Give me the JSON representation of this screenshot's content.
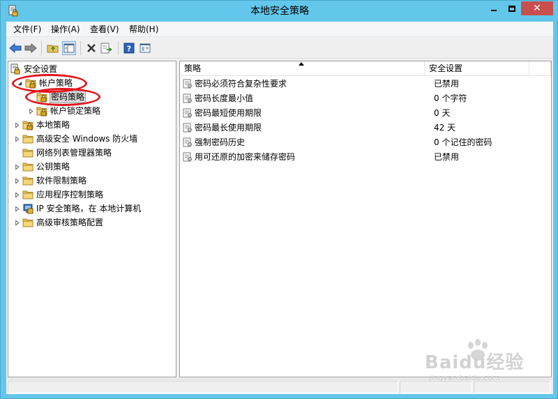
{
  "window": {
    "title": "本地安全策略",
    "close_glyph": "✕"
  },
  "menu": [
    {
      "label": "文件(F)"
    },
    {
      "label": "操作(A)"
    },
    {
      "label": "查看(V)"
    },
    {
      "label": "帮助(H)"
    }
  ],
  "toolbar": {
    "icons": [
      "back-arrow-icon",
      "forward-arrow-icon",
      "up-folder-icon",
      "show-hide-tree-icon",
      "delete-icon",
      "export-list-icon",
      "help-icon",
      "console-icon"
    ]
  },
  "tree": {
    "items": [
      {
        "label": "安全设置"
      },
      {
        "label": "帐户策略"
      },
      {
        "label": "密码策略"
      },
      {
        "label": "帐户锁定策略"
      },
      {
        "label": "本地策略"
      },
      {
        "label": "高级安全 Windows 防火墙"
      },
      {
        "label": "网络列表管理器策略"
      },
      {
        "label": "公钥策略"
      },
      {
        "label": "软件限制策略"
      },
      {
        "label": "应用程序控制策略"
      },
      {
        "label": "IP 安全策略，在 本地计算机"
      },
      {
        "label": "高级审核策略配置"
      }
    ]
  },
  "list": {
    "columns": [
      {
        "label": "策略"
      },
      {
        "label": "安全设置"
      }
    ],
    "rows": [
      {
        "policy": "密码必须符合复杂性要求",
        "setting": "已禁用"
      },
      {
        "policy": "密码长度最小值",
        "setting": "0 个字符"
      },
      {
        "policy": "密码最短使用期限",
        "setting": "0 天"
      },
      {
        "policy": "密码最长使用期限",
        "setting": "42 天"
      },
      {
        "policy": "强制密码历史",
        "setting": "0 个记住的密码"
      },
      {
        "policy": "用可还原的加密来储存密码",
        "setting": "已禁用"
      }
    ]
  },
  "watermark": {
    "logo_text": "Baidu经验",
    "sub_text": "jingyan.baidu.com"
  },
  "colors": {
    "titlebar": "#62c7ea",
    "close_button": "#c7504f",
    "annotation_circle": "#e3141b",
    "folder_yellow": "#e8c55a"
  }
}
